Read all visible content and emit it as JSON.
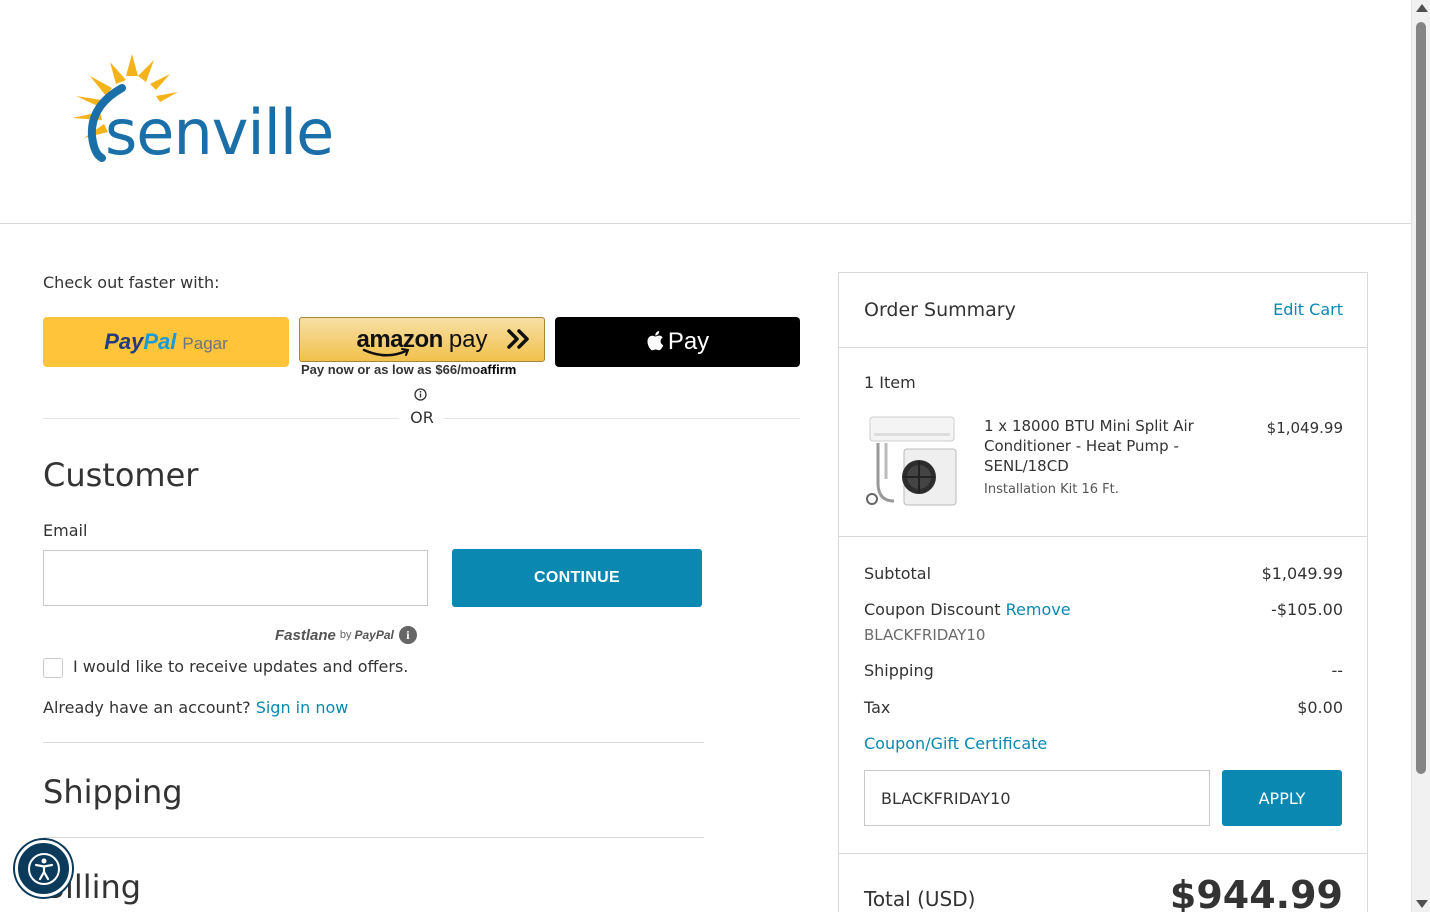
{
  "brand": {
    "logo_text": "senville",
    "colors": {
      "primary": "#0a88b1",
      "logo_blue": "#1a6fa8",
      "sun_yellow": "#f5b31b"
    }
  },
  "express_checkout": {
    "label": "Check out faster with:",
    "paypal": {
      "brand1": "Pay",
      "brand2": "Pal",
      "sub": "Pagar"
    },
    "amazon": {
      "brand1": "amazon",
      "brand2": "pay"
    },
    "affirm": {
      "text": "Pay now or as low as $66/mo",
      "logo": "affirm"
    },
    "apple": {
      "text": "Pay"
    },
    "or_text": "OR"
  },
  "customer": {
    "heading": "Customer",
    "email_label": "Email",
    "email_value": "",
    "continue_label": "CONTINUE",
    "fastlane": {
      "brand": "Fastlane",
      "by": "by",
      "paypal": "PayPal",
      "info": "i"
    },
    "optin_label": "I would like to receive updates and offers.",
    "account_prefix": "Already have an account?",
    "sign_in_label": "Sign in now"
  },
  "sections": {
    "shipping": "Shipping",
    "billing": "Billing"
  },
  "order_summary": {
    "title": "Order Summary",
    "edit_cart": "Edit Cart",
    "items_count": "1 Item",
    "product": {
      "name": "1 x 18000 BTU Mini Split Air Conditioner - Heat Pump - SENL/18CD",
      "option": "Installation Kit 16 Ft.",
      "price": "$1,049.99"
    },
    "subtotal_label": "Subtotal",
    "subtotal_value": "$1,049.99",
    "coupon_label": "Coupon Discount",
    "coupon_remove": "Remove",
    "coupon_value": "-$105.00",
    "coupon_code": "BLACKFRIDAY10",
    "shipping_label": "Shipping",
    "shipping_value": "--",
    "tax_label": "Tax",
    "tax_value": "$0.00",
    "coupon_link": "Coupon/Gift Certificate",
    "coupon_input_value": "BLACKFRIDAY10",
    "apply_label": "APPLY",
    "total_label": "Total (USD)",
    "total_value": "$944.99"
  },
  "icons": {
    "accessibility": "accessibility-icon",
    "apple": "apple-icon",
    "chevron": "double-chevron-right-icon",
    "info": "info-icon"
  }
}
